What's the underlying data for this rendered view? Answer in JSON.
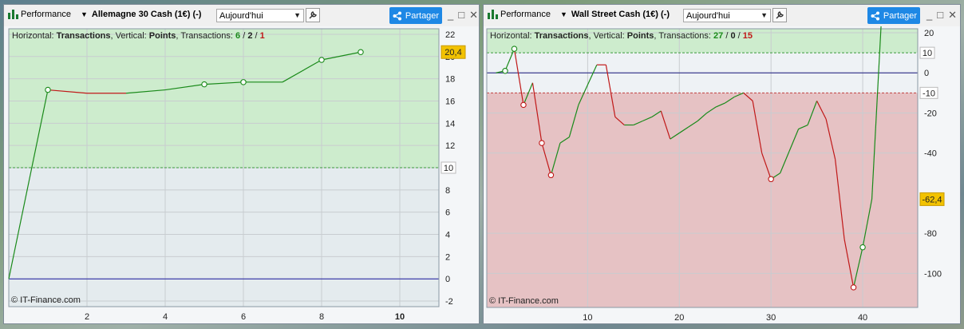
{
  "windows": [
    {
      "perf_label": "Performance",
      "instrument": "Allemagne 30 Cash (1€) (-)",
      "period": "Aujourd'hui",
      "share_label": "Partager",
      "info": {
        "h_prefix": "Horizontal: ",
        "h_val": "Transactions",
        "v_prefix": ", Vertical: ",
        "v_val": "Points",
        "t_prefix": ", Transactions: ",
        "t_green": "6",
        "sep1": " / ",
        "t_neutral": "2",
        "sep2": " / ",
        "t_red": "1"
      },
      "copyright": "© IT-Finance.com",
      "chart_data": {
        "type": "line",
        "x": [
          0,
          1,
          2,
          3,
          4,
          5,
          6,
          7,
          8,
          9
        ],
        "y": [
          0,
          17,
          16.7,
          16.7,
          17,
          17.5,
          17.7,
          17.7,
          19.7,
          20.4
        ],
        "markers": [
          1,
          5,
          6,
          8,
          9
        ],
        "segment_colors": [
          "green",
          "red",
          "red",
          "green",
          "green",
          "green",
          "green",
          "green",
          "green"
        ],
        "xlim": [
          0,
          11
        ],
        "ylim": [
          -2.5,
          22.5
        ],
        "xticks": [
          2,
          4,
          6,
          8,
          10
        ],
        "xtick_labels": [
          "2",
          "4",
          "6",
          "8",
          "10"
        ],
        "yticks": [
          -2,
          0,
          2,
          4,
          6,
          8,
          10,
          12,
          14,
          16,
          18,
          20,
          22
        ],
        "ytick_labels": [
          "-2",
          "0",
          "2",
          "4",
          "6",
          "8",
          "10",
          "12",
          "14",
          "16",
          "18",
          "20",
          "22"
        ],
        "target_upper": 10,
        "target_upper_label": "10",
        "zero_line": 0,
        "last_value_label": "20,4",
        "colors": {
          "green": "#1a8a1a",
          "red": "#c01818",
          "zero": "#1a1aa0",
          "top_bg": "#cdeccd",
          "bottom_bg": "#e4ebee"
        }
      }
    },
    {
      "perf_label": "Performance",
      "instrument": "Wall Street Cash (1€) (-)",
      "period": "Aujourd'hui",
      "share_label": "Partager",
      "info": {
        "h_prefix": "Horizontal: ",
        "h_val": "Transactions",
        "v_prefix": ", Vertical: ",
        "v_val": "Points",
        "t_prefix": ", Transactions: ",
        "t_green": "27",
        "sep1": " / ",
        "t_neutral": "0",
        "sep2": " / ",
        "t_red": "15"
      },
      "copyright": "© IT-Finance.com",
      "chart_data": {
        "type": "line",
        "x": [
          0,
          1,
          2,
          3,
          4,
          5,
          6,
          7,
          8,
          9,
          10,
          11,
          12,
          13,
          14,
          15,
          16,
          17,
          18,
          19,
          20,
          21,
          22,
          23,
          24,
          25,
          26,
          27,
          28,
          29,
          30,
          31,
          32,
          33,
          34,
          35,
          36,
          37,
          38,
          39,
          40,
          41,
          42
        ],
        "y": [
          0,
          1,
          12,
          -16,
          -5,
          -35,
          -51,
          -35,
          -32,
          -16,
          -6,
          4,
          4,
          -22,
          -26,
          -26,
          -24,
          -22,
          -19,
          -33,
          -30,
          -27,
          -24,
          -20,
          -17,
          -15,
          -12,
          -10,
          -14,
          -40,
          -53,
          -50,
          -39,
          -28,
          -26,
          -14,
          -23,
          -43,
          -83,
          -107,
          -87,
          -63
        ],
        "x_fix": null,
        "markers": [
          1,
          2,
          3,
          5,
          6,
          30,
          39,
          40
        ],
        "segment_colors": [
          "green",
          "green",
          "red",
          "green",
          "red",
          "red",
          "green",
          "green",
          "green",
          "green",
          "green",
          "red",
          "red",
          "red",
          "green",
          "green",
          "green",
          "green",
          "red",
          "green",
          "green",
          "green",
          "green",
          "green",
          "green",
          "green",
          "green",
          "red",
          "red",
          "red",
          "green",
          "green",
          "green",
          "green",
          "green",
          "red",
          "red",
          "red",
          "red",
          "green",
          "green"
        ],
        "xlim": [
          -1,
          46
        ],
        "ylim": [
          -117,
          22
        ],
        "xticks": [
          10,
          20,
          30,
          40
        ],
        "xtick_labels": [
          "10",
          "20",
          "30",
          "40"
        ],
        "yticks": [
          20,
          0,
          -20,
          -40,
          -80,
          -100
        ],
        "ytick_labels": [
          "20",
          "0",
          "-20",
          "-40",
          "-80",
          "-100"
        ],
        "target_upper": 10,
        "target_upper_label": "10",
        "target_lower": -10,
        "target_lower_label": "-10",
        "zero_line": 0,
        "last_value_label": "-62,4",
        "colors": {
          "green": "#1a8a1a",
          "red": "#c01818",
          "zero": "#1a1a80",
          "top_bg": "#cdeccd",
          "mid_bg": "#eef2f5",
          "bottom_bg": "#e6c2c4"
        }
      }
    }
  ]
}
